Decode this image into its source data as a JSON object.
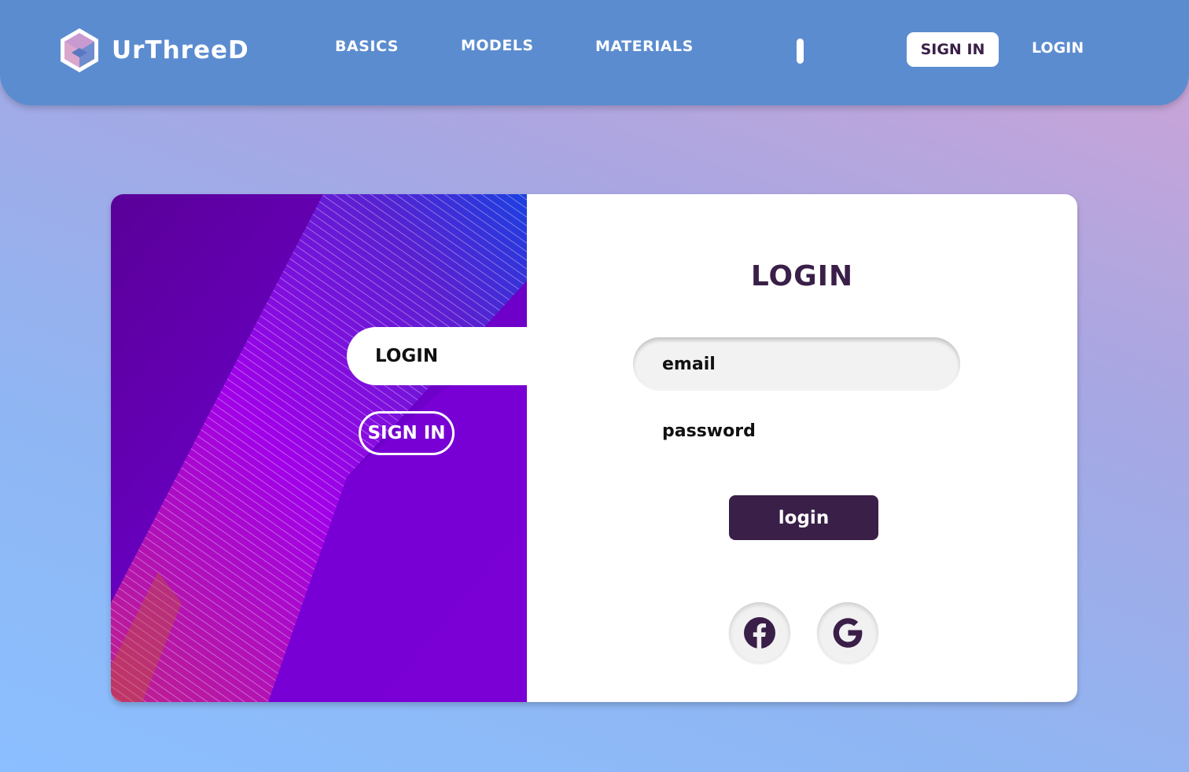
{
  "brand": {
    "name": "UrThreeD"
  },
  "nav": {
    "items": [
      {
        "label": "BASICS"
      },
      {
        "label": "MODELS"
      },
      {
        "label": "MATERIALS"
      }
    ],
    "signin_label": "SIGN IN",
    "login_label": "LOGIN"
  },
  "auth_panel": {
    "tabs": {
      "login": "LOGIN",
      "signin": "SIGN IN"
    }
  },
  "form": {
    "title": "LOGIN",
    "email_placeholder": "email",
    "password_placeholder": "password",
    "submit_label": "login",
    "social": [
      {
        "icon": "facebook-icon"
      },
      {
        "icon": "google-icon"
      }
    ]
  },
  "colors": {
    "header": "#5b8cd0",
    "accent_dark": "#3a1f48",
    "panel_purple": "#6a00c8",
    "field_bg": "#f2f2f2"
  }
}
